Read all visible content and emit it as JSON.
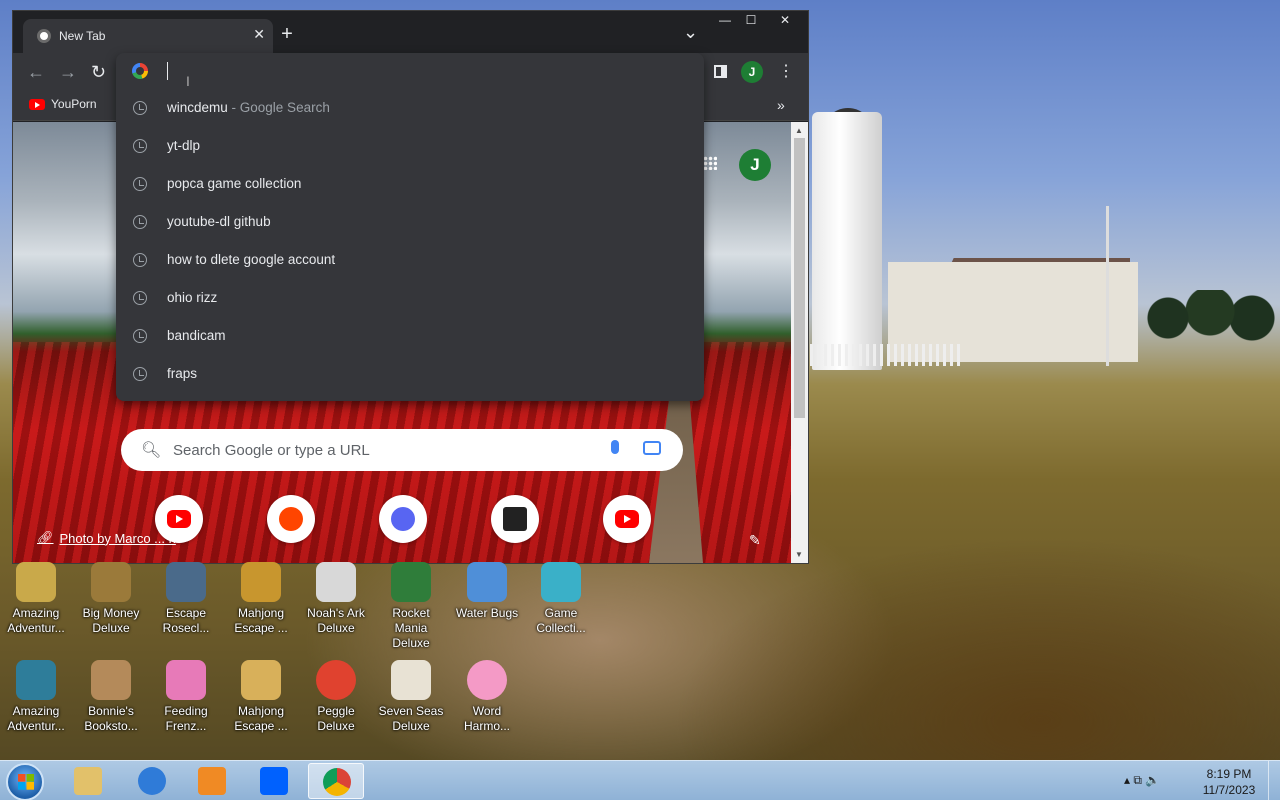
{
  "browser": {
    "tab_title": "New Tab",
    "tab_close": "✕",
    "new_tab": "+",
    "tab_search": "⌄",
    "window_controls": {
      "minimize": "—",
      "maximize": "☐",
      "close": "✕"
    },
    "toolbar": {
      "back": "←",
      "forward": "→",
      "reload": "↻",
      "menu": "⋮",
      "avatar_letter": "J"
    },
    "bookmarks": [
      {
        "label": "YouPorn"
      }
    ],
    "bookmarks_more": "»"
  },
  "omnibox": {
    "value": "",
    "suggestions": [
      {
        "text": "wincdemu",
        "hint": " - Google Search"
      },
      {
        "text": "yt-dlp",
        "hint": ""
      },
      {
        "text": "popca game collection",
        "hint": ""
      },
      {
        "text": "youtube-dl github",
        "hint": ""
      },
      {
        "text": "how to dlete google account",
        "hint": ""
      },
      {
        "text": "ohio rizz",
        "hint": ""
      },
      {
        "text": "bandicam",
        "hint": ""
      },
      {
        "text": "fraps",
        "hint": ""
      }
    ]
  },
  "ntp": {
    "avatar_letter": "J",
    "search_placeholder": "Search Google or type a URL",
    "shortcuts": [
      "youtube",
      "reddit",
      "discord",
      "archive",
      "youtube"
    ],
    "photo_credit": "Photo by Marco ... n"
  },
  "desktop": {
    "row1": [
      {
        "label": "Amazing Adventur...",
        "color": "#c9a94a"
      },
      {
        "label": "Big Money Deluxe",
        "color": "#9b7a3a"
      },
      {
        "label": "Escape Rosecl...",
        "color": "#4a6a8a"
      },
      {
        "label": "Mahjong Escape ...",
        "color": "#c8962e"
      },
      {
        "label": "Noah's Ark Deluxe",
        "color": "#d8d8d8"
      },
      {
        "label": "Rocket Mania Deluxe",
        "color": "#2f7d3a"
      },
      {
        "label": "Water Bugs",
        "color": "#4f8fd8"
      },
      {
        "label": "Game Collecti...",
        "color": "#3ab0c8"
      }
    ],
    "row2": [
      {
        "label": "Amazing Adventur...",
        "color": "#2e7d9a"
      },
      {
        "label": "Bonnie's Booksto...",
        "color": "#b48a5a"
      },
      {
        "label": "Feeding Frenz...",
        "color": "#e77ab8"
      },
      {
        "label": "Mahjong Escape ...",
        "color": "#d8b05a"
      },
      {
        "label": "Peggle Deluxe",
        "color": "#e0422f"
      },
      {
        "label": "Seven Seas Deluxe",
        "color": "#e8e2d4"
      },
      {
        "label": "Word Harmo...",
        "color": "#f49ac6"
      }
    ]
  },
  "taskbar": {
    "apps": [
      {
        "name": "explorer",
        "color": "#e2c16a"
      },
      {
        "name": "internet-explorer",
        "color": "#2f7bd8"
      },
      {
        "name": "media-player",
        "color": "#f08a24"
      },
      {
        "name": "dropbox",
        "color": "#0061fe"
      },
      {
        "name": "chrome",
        "color": "#db4437"
      }
    ],
    "tray_icons": "▴  ⧉  🔈",
    "time": "8:19 PM",
    "date": "11/7/2023"
  }
}
